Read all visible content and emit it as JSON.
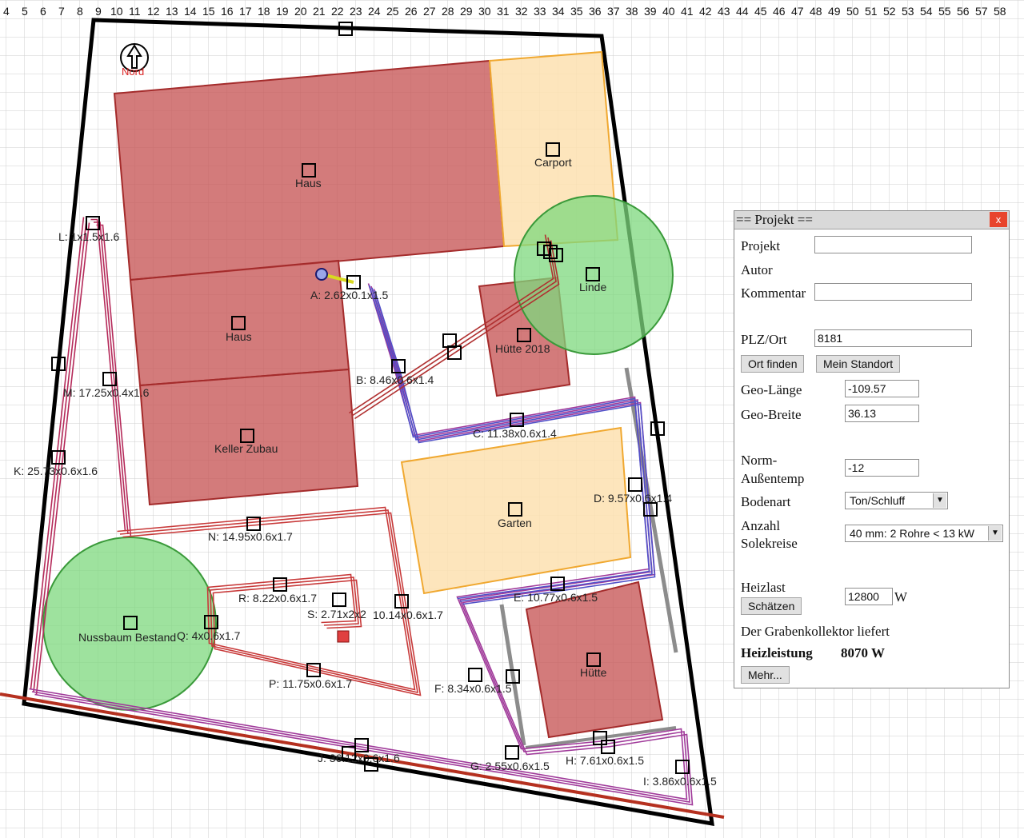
{
  "ruler": {
    "numbers": [
      "4",
      "5",
      "6",
      "7",
      "8",
      "9",
      "10",
      "11",
      "12",
      "13",
      "14",
      "15",
      "16",
      "17",
      "18",
      "19",
      "20",
      "21",
      "22",
      "23",
      "24",
      "25",
      "26",
      "27",
      "28",
      "29",
      "30",
      "31",
      "32",
      "33",
      "34",
      "35",
      "36",
      "37",
      "38",
      "39",
      "40",
      "41",
      "42",
      "43",
      "44",
      "45",
      "46",
      "47",
      "48",
      "49",
      "50",
      "51",
      "52",
      "53",
      "54",
      "55",
      "56",
      "57",
      "58"
    ]
  },
  "map": {
    "north_label": "Nord",
    "areas": {
      "haus_top": "Haus",
      "haus_mid": "Haus",
      "keller": "Keller Zubau",
      "carport": "Carport",
      "huette2018": "Hütte 2018",
      "garten": "Garten",
      "huette": "Hütte",
      "linde": "Linde",
      "nussbaum": "Nussbaum Bestand"
    },
    "segments": {
      "A": "A: 2.62x0.1x1.5",
      "B": "B: 8.46x0.6x1.4",
      "C": "C: 11.38x0.6x1.4",
      "D": "D: 9.57x0.6x1.4",
      "E": "E: 10.77x0.6x1.5",
      "F": "F: 8.34x0.6x1.5",
      "G": "G: 2.55x0.6x1.5",
      "H": "H: 7.61x0.6x1.5",
      "I": "I: 3.86x0.6x1.5",
      "J": "J: 36.12x0.6x1.6",
      "K": "K: 25.73x0.6x1.6",
      "L": "L: 1x1.5x1.6",
      "M": "M: 17.25x0.4x1.6",
      "N": "N: 14.95x0.6x1.7",
      "O": "10.14x0.6x1.7",
      "P": "P: 11.75x0.6x1.7",
      "Q": "Q: 4x0.6x1.7",
      "R": "R: 8.22x0.6x1.7",
      "S": "S: 2.71x2x2"
    }
  },
  "dialog": {
    "title": "== Projekt ==",
    "close": "x",
    "projekt_label": "Projekt",
    "projekt_value": "",
    "autor_label": "Autor",
    "kommentar_label": "Kommentar",
    "kommentar_value": "",
    "plz_label": "PLZ/Ort",
    "plz_value": "8181",
    "ort_finden": "Ort finden",
    "mein_standort": "Mein Standort",
    "geo_laenge_label": "Geo-Länge",
    "geo_laenge_value": "-109.57",
    "geo_breite_label": "Geo-Breite",
    "geo_breite_value": "36.13",
    "norm_label_1": "Norm-",
    "norm_label_2": "Außentemp",
    "norm_value": "-12",
    "bodenart_label": "Bodenart",
    "bodenart_value": "Ton/Schluff",
    "anzahl_label_1": "Anzahl",
    "anzahl_label_2": "Solekreise",
    "anzahl_value": "40 mm: 2 Rohre < 13 kW",
    "heizlast_label": "Heizlast",
    "heizlast_value": "12800",
    "heizlast_unit": "W",
    "schaetzen": "Schätzen",
    "liefert_text": "Der Grabenkollektor liefert",
    "heizleistung_label": "Heizleistung",
    "heizleistung_value": "8070 W",
    "mehr": "Mehr..."
  }
}
